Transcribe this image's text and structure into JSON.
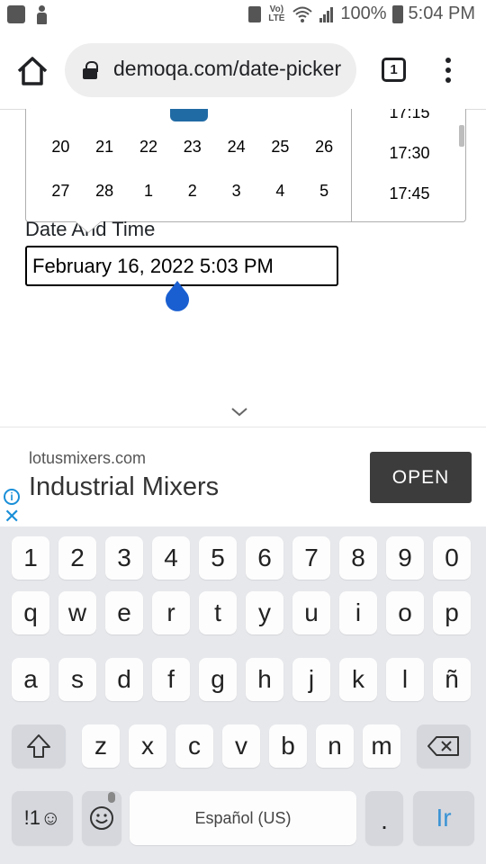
{
  "status_bar": {
    "signal_label": "Vo) LTE",
    "battery_percent": "100%",
    "time": "5:04 PM"
  },
  "browser": {
    "url": "demoqa.com/date-picker",
    "tab_count": "1"
  },
  "calendar": {
    "weeks": [
      [
        "20",
        "21",
        "22",
        "23",
        "24",
        "25",
        "26"
      ],
      [
        "27",
        "28",
        "1",
        "2",
        "3",
        "4",
        "5"
      ]
    ],
    "times": [
      "17:15",
      "17:30",
      "17:45"
    ]
  },
  "form": {
    "label": "Date And Time",
    "value": "February 16, 2022 5:03 PM"
  },
  "ad": {
    "domain": "lotusmixers.com",
    "title": "Industrial Mixers",
    "button": "OPEN",
    "info_glyph": "i",
    "close_glyph": "✕"
  },
  "keyboard": {
    "numbers": [
      "1",
      "2",
      "3",
      "4",
      "5",
      "6",
      "7",
      "8",
      "9",
      "0"
    ],
    "row1": [
      "q",
      "w",
      "e",
      "r",
      "t",
      "y",
      "u",
      "i",
      "o",
      "p"
    ],
    "row2": [
      "a",
      "s",
      "d",
      "f",
      "g",
      "h",
      "j",
      "k",
      "l",
      "ñ"
    ],
    "row3": [
      "z",
      "x",
      "c",
      "v",
      "b",
      "n",
      "m"
    ],
    "symbols_key": "!1☺",
    "space_label": "Español (US)",
    "period": ".",
    "go_label": "Ir"
  },
  "colors": {
    "selected_day": "#216ba5",
    "caret_handle": "#1a5fd1",
    "ad_accent": "#1a8fd8",
    "go_key": "#3a93d4"
  }
}
